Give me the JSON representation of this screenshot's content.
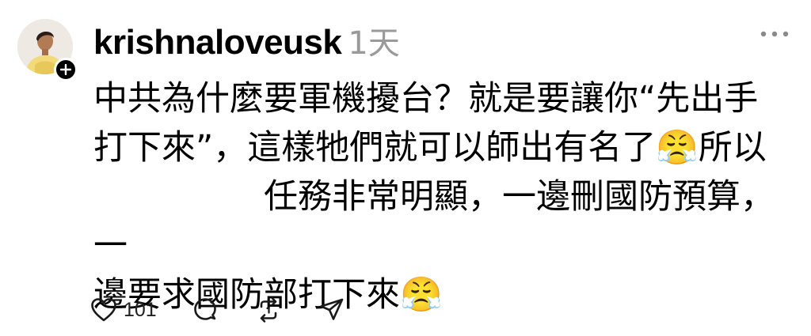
{
  "post": {
    "username": "krishnaloveusk",
    "timestamp": "1天",
    "text": "中共為什麼要軍機擾台？就是要讓你“先出手\n打下來”，這樣牠們就可以師出有名了😤所以\n　　　　　任務非常明顯，一邊刪國防預算，一\n邊要求國防部打下來😤",
    "like_count": "101"
  },
  "icons": {
    "avatar": "avatar-photo",
    "follow": "plus-icon",
    "more": "more-horizontal-icon",
    "like": "heart-icon",
    "reply": "comment-icon",
    "repost": "repost-icon",
    "share": "send-icon"
  },
  "colors": {
    "text": "#000000",
    "muted": "#9a9a9a",
    "badge": "#000000",
    "background": "#ffffff"
  }
}
